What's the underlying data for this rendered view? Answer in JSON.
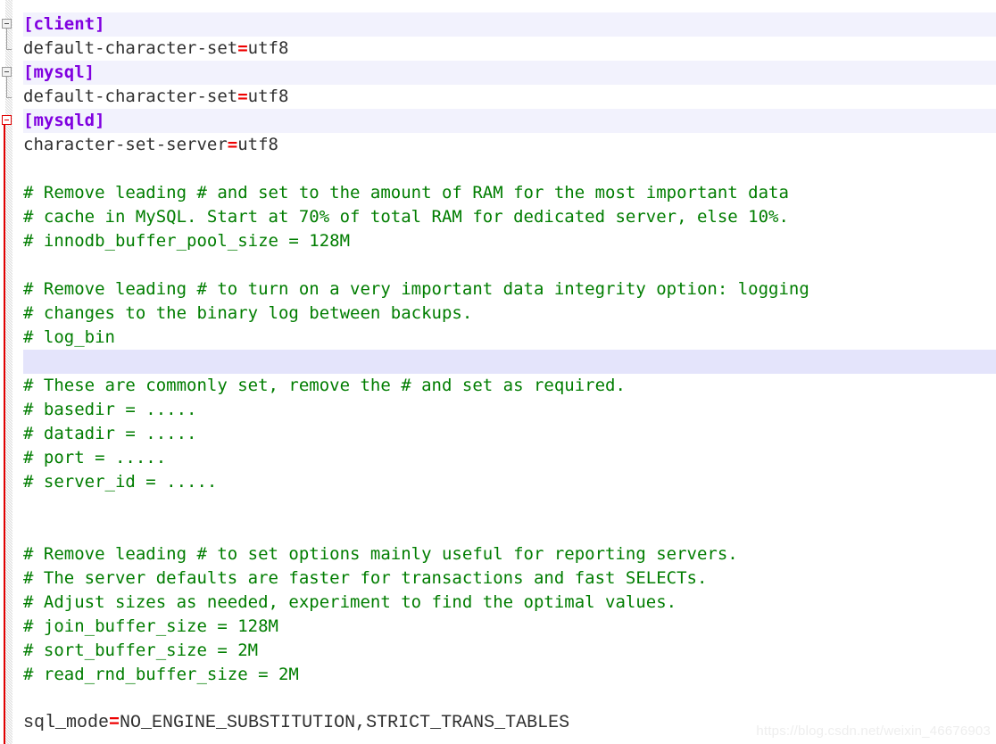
{
  "editor": {
    "file_kind": "mysql-ini-config",
    "line_height_px": 27,
    "colors": {
      "background": "#ffffff",
      "text": "#303030",
      "section_header": "#8000e0",
      "equals": "#ee0000",
      "comment": "#007d00",
      "section_line_highlight": "#f2f2fd",
      "cursor_line_highlight": "#e4e4fb",
      "caret": "#6a35d6",
      "fold_marker": "#9a9a9a",
      "fold_marker_active": "#e00000",
      "watermark": "#eeeeee"
    }
  },
  "gutter": {
    "fold_markers": [
      {
        "name": "fold-marker-client",
        "label": "−",
        "state": "expanded",
        "active": false
      },
      {
        "name": "fold-marker-mysql",
        "label": "−",
        "state": "expanded",
        "active": false
      },
      {
        "name": "fold-marker-mysqld",
        "label": "−",
        "state": "expanded",
        "active": true
      }
    ]
  },
  "lines": [
    {
      "n": 1,
      "kind": "section",
      "section": "[client]"
    },
    {
      "n": 2,
      "kind": "setting",
      "key": "default-character-set",
      "eq": "=",
      "value": "utf8"
    },
    {
      "n": 3,
      "kind": "section",
      "section": "[mysql]"
    },
    {
      "n": 4,
      "kind": "setting",
      "key": "default-character-set",
      "eq": "=",
      "value": "utf8"
    },
    {
      "n": 5,
      "kind": "section",
      "section": "[mysqld]"
    },
    {
      "n": 6,
      "kind": "setting",
      "key": "character-set-server",
      "eq": "=",
      "value": "utf8"
    },
    {
      "n": 7,
      "kind": "blank",
      "text": ""
    },
    {
      "n": 8,
      "kind": "comment",
      "text": "# Remove leading # and set to the amount of RAM for the most important data"
    },
    {
      "n": 9,
      "kind": "comment",
      "text": "# cache in MySQL. Start at 70% of total RAM for dedicated server, else 10%."
    },
    {
      "n": 10,
      "kind": "comment",
      "text": "# innodb_buffer_pool_size = 128M"
    },
    {
      "n": 11,
      "kind": "blank",
      "text": ""
    },
    {
      "n": 12,
      "kind": "comment",
      "text": "# Remove leading # to turn on a very important data integrity option: logging"
    },
    {
      "n": 13,
      "kind": "comment",
      "text": "# changes to the binary log between backups."
    },
    {
      "n": 14,
      "kind": "comment",
      "text": "# log_bin"
    },
    {
      "n": 15,
      "kind": "cursor",
      "text": ""
    },
    {
      "n": 16,
      "kind": "comment",
      "text": "# These are commonly set, remove the # and set as required."
    },
    {
      "n": 17,
      "kind": "comment",
      "text": "# basedir = ....."
    },
    {
      "n": 18,
      "kind": "comment",
      "text": "# datadir = ....."
    },
    {
      "n": 19,
      "kind": "comment",
      "text": "# port = ....."
    },
    {
      "n": 20,
      "kind": "comment",
      "text": "# server_id = ....."
    },
    {
      "n": 21,
      "kind": "blank",
      "text": ""
    },
    {
      "n": 22,
      "kind": "blank",
      "text": ""
    },
    {
      "n": 23,
      "kind": "comment",
      "text": "# Remove leading # to set options mainly useful for reporting servers."
    },
    {
      "n": 24,
      "kind": "comment",
      "text": "# The server defaults are faster for transactions and fast SELECTs."
    },
    {
      "n": 25,
      "kind": "comment",
      "text": "# Adjust sizes as needed, experiment to find the optimal values."
    },
    {
      "n": 26,
      "kind": "comment",
      "text": "# join_buffer_size = 128M"
    },
    {
      "n": 27,
      "kind": "comment",
      "text": "# sort_buffer_size = 2M"
    },
    {
      "n": 28,
      "kind": "comment",
      "text": "# read_rnd_buffer_size = 2M"
    },
    {
      "n": 29,
      "kind": "blank",
      "text": ""
    },
    {
      "n": 30,
      "kind": "setting_narrow",
      "key": "sql_mode",
      "eq": "=",
      "value": "NO_ENGINE_SUBSTITUTION,STRICT_TRANS_TABLES"
    }
  ],
  "watermark": {
    "text": "https://blog.csdn.net/weixin_46676903"
  }
}
